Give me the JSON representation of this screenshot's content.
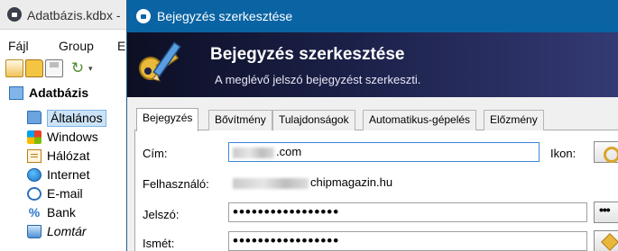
{
  "main_window": {
    "title": "Adatbázis.kdbx -",
    "menu": [
      "Fájl",
      "Group",
      "Er"
    ],
    "tree": {
      "root": "Adatbázis",
      "items": [
        {
          "label": "Általános",
          "icon": "folder-icon",
          "selected": true
        },
        {
          "label": "Windows",
          "icon": "windows-icon"
        },
        {
          "label": "Hálózat",
          "icon": "network-icon"
        },
        {
          "label": "Internet",
          "icon": "globe-icon"
        },
        {
          "label": "E-mail",
          "icon": "email-icon"
        },
        {
          "label": "Bank",
          "icon": "bank-icon"
        },
        {
          "label": "Lomtár",
          "icon": "trash-icon",
          "italic": true
        }
      ]
    }
  },
  "dialog": {
    "title": "Bejegyzés szerkesztése",
    "banner": {
      "title": "Bejegyzés szerkesztése",
      "subtitle": "A meglévő jelszó bejegyzést szerkeszti."
    },
    "tabs": [
      "Bejegyzés",
      "Bővítmény",
      "Tulajdonságok",
      "Automatikus-gépelés",
      "Előzmény"
    ],
    "active_tab": "Bejegyzés",
    "fields": {
      "title_label": "Cím:",
      "title_value": ".com",
      "icon_label": "Ikon:",
      "user_label": "Felhasználó:",
      "user_value": "chipmagazin.hu",
      "password_label": "Jelszó:",
      "password_value": "•••••••••••••••••",
      "repeat_label": "Ismét:",
      "repeat_value": "•••••••••••••••••",
      "show_password_button": "•••"
    }
  },
  "colors": {
    "dialog_titlebar": "#0a64a4",
    "banner_start": "#0d0f24",
    "banner_end": "#343a74",
    "selection": "#cce3f7"
  }
}
